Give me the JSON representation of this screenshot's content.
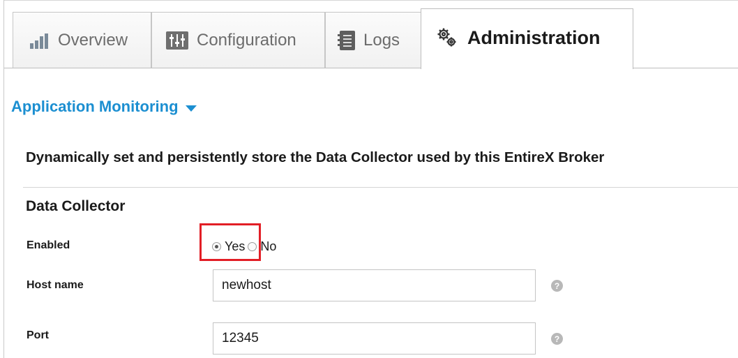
{
  "tabs": {
    "overview": {
      "label": "Overview",
      "icon": "bar-chart-icon"
    },
    "configuration": {
      "label": "Configuration",
      "icon": "config-panel-icon"
    },
    "logs": {
      "label": "Logs",
      "icon": "notebook-icon"
    },
    "administration": {
      "label": "Administration",
      "icon": "gears-icon",
      "active": true
    }
  },
  "section_menu": {
    "label": "Application Monitoring",
    "icon": "caret-down-icon"
  },
  "description": "Dynamically set and persistently store the Data Collector used by this EntireX Broker",
  "form": {
    "title": "Data Collector",
    "enabled": {
      "label": "Enabled",
      "options": [
        "Yes",
        "No"
      ],
      "selected": "Yes"
    },
    "host": {
      "label": "Host name",
      "value": "newhost"
    },
    "port": {
      "label": "Port",
      "value": "12345"
    },
    "help_glyph": "?"
  },
  "colors": {
    "accent": "#1c8fd1",
    "highlight": "#e21e26"
  }
}
